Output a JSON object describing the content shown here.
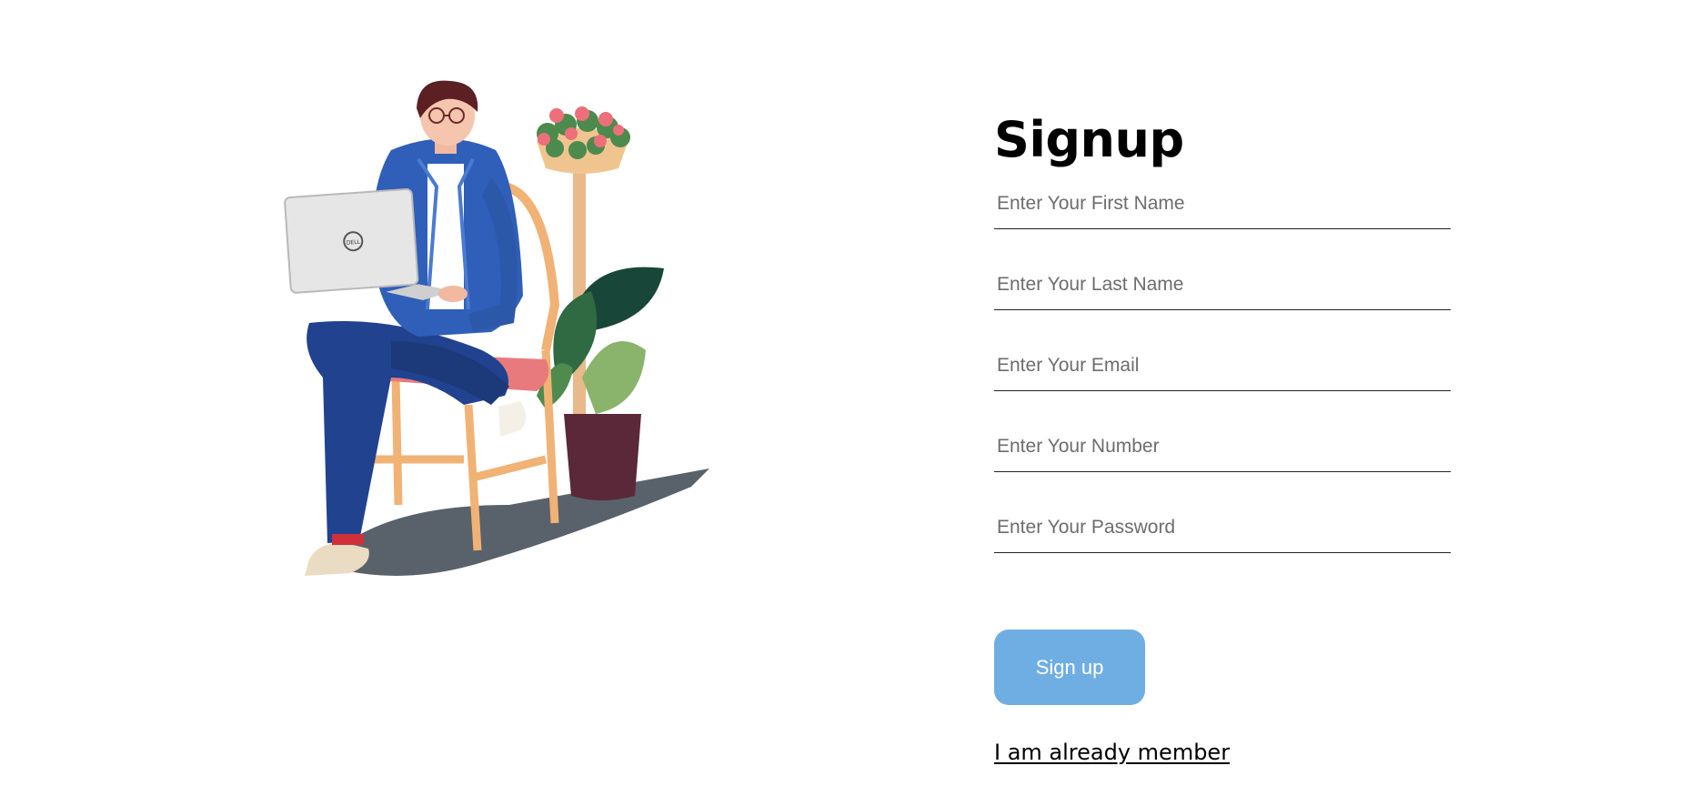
{
  "illustration": {
    "name": "man-with-laptop-illustration",
    "laptop_brand": "DELL"
  },
  "form": {
    "title": "Signup",
    "fields": [
      {
        "name": "first-name-input",
        "placeholder": "Enter Your First Name",
        "value": ""
      },
      {
        "name": "last-name-input",
        "placeholder": "Enter Your Last Name",
        "value": ""
      },
      {
        "name": "email-input",
        "placeholder": "Enter Your Email",
        "value": ""
      },
      {
        "name": "number-input",
        "placeholder": "Enter Your Number",
        "value": ""
      },
      {
        "name": "password-input",
        "placeholder": "Enter Your Password",
        "value": ""
      }
    ],
    "submit_label": "Sign up",
    "login_link": "I am already member"
  },
  "colors": {
    "button": "#6faee3",
    "text": "#000000",
    "underline": "#222222"
  }
}
